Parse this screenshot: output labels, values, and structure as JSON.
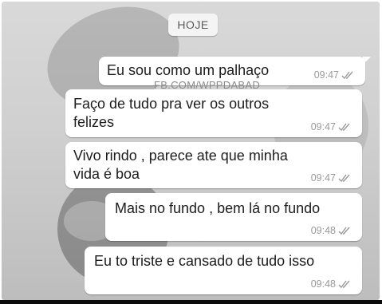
{
  "chat": {
    "date_label": "HOJE",
    "watermark": "FB.COM/WPPDABAD",
    "messages": [
      {
        "text": "Eu sou como um palhaço",
        "time": "09:47",
        "status_icon": "double-check-icon"
      },
      {
        "text": "Faço de tudo pra ver os outros felizes",
        "time": "09:47",
        "status_icon": "double-check-icon"
      },
      {
        "text": "Vivo rindo , parece ate que minha vida é boa",
        "time": "09:47",
        "status_icon": "double-check-icon"
      },
      {
        "text": "Mais no fundo , bem lá no fundo",
        "time": "09:48",
        "status_icon": "double-check-icon"
      },
      {
        "text": "Eu to triste e cansado de tudo isso",
        "time": "09:48",
        "status_icon": "double-check-icon"
      }
    ]
  },
  "colors": {
    "bubble": "#ffffff",
    "meta_text": "#9a9a9a",
    "check": "#9a9a9a",
    "background": "#d0d0d0"
  }
}
